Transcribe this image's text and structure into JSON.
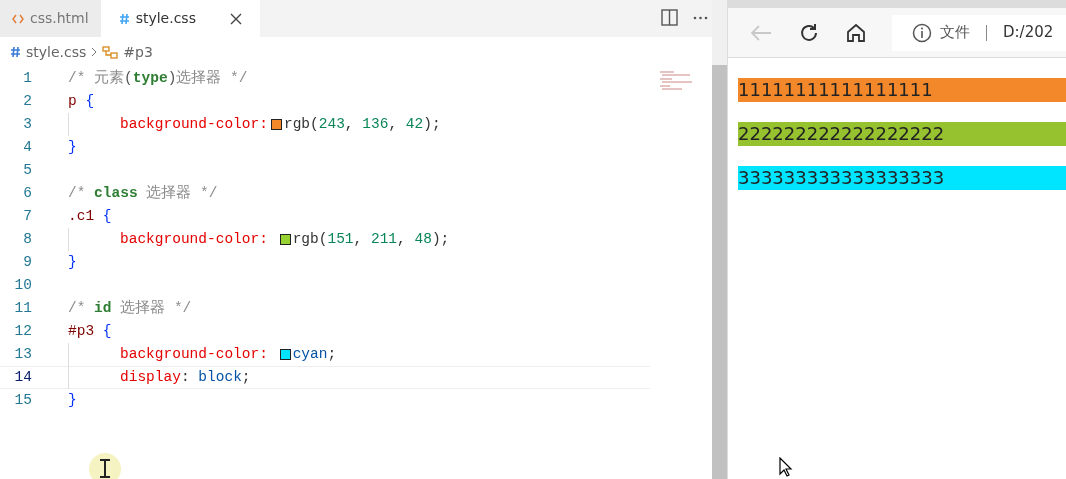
{
  "editor": {
    "tabs": [
      {
        "kind": "html",
        "label": "css.html",
        "selected": false
      },
      {
        "kind": "css",
        "label": "style.css",
        "selected": true
      }
    ],
    "breadcrumb": [
      {
        "kind": "file",
        "label": "style.css"
      },
      {
        "kind": "symbol",
        "label": "#p3"
      }
    ],
    "lines": [
      {
        "number": "1",
        "current": false,
        "tokens": [
          {
            "kind": "comment",
            "text": "/* 元素"
          },
          {
            "kind": "punct",
            "text": "("
          },
          {
            "kind": "keyword",
            "text": "type"
          },
          {
            "kind": "punct",
            "text": ")"
          },
          {
            "kind": "comment",
            "text": "选择器 */"
          }
        ]
      },
      {
        "number": "2",
        "current": false,
        "tokens": [
          {
            "kind": "selector",
            "text": "p"
          },
          {
            "kind": "brace",
            "text": " {"
          }
        ]
      },
      {
        "number": "3",
        "current": false,
        "tokens": [
          {
            "kind": "indent"
          },
          {
            "kind": "property",
            "text": "background-color:"
          },
          {
            "kind": "swatch",
            "color": "#f3882a"
          },
          {
            "kind": "plain",
            "text": "rgb("
          },
          {
            "kind": "number",
            "text": "243"
          },
          {
            "kind": "plain",
            "text": ", "
          },
          {
            "kind": "number",
            "text": "136"
          },
          {
            "kind": "plain",
            "text": ", "
          },
          {
            "kind": "number",
            "text": "42"
          },
          {
            "kind": "plain",
            "text": ");"
          }
        ]
      },
      {
        "number": "4",
        "current": false,
        "tokens": [
          {
            "kind": "brace",
            "text": "}"
          }
        ]
      },
      {
        "number": "5",
        "current": false
      },
      {
        "number": "6",
        "current": false,
        "tokens": [
          {
            "kind": "comment",
            "text": "/* "
          },
          {
            "kind": "keyword",
            "text": "class"
          },
          {
            "kind": "comment",
            "text": " 选择器 */"
          }
        ]
      },
      {
        "number": "7",
        "current": false,
        "tokens": [
          {
            "kind": "selector",
            "text": ".c1"
          },
          {
            "kind": "brace",
            "text": " {"
          }
        ]
      },
      {
        "number": "8",
        "current": false,
        "tokens": [
          {
            "kind": "indent"
          },
          {
            "kind": "property",
            "text": "background-color: "
          },
          {
            "kind": "swatch",
            "color": "#97d330"
          },
          {
            "kind": "plain",
            "text": "rgb("
          },
          {
            "kind": "number",
            "text": "151"
          },
          {
            "kind": "plain",
            "text": ", "
          },
          {
            "kind": "number",
            "text": "211"
          },
          {
            "kind": "plain",
            "text": ", "
          },
          {
            "kind": "number",
            "text": "48"
          },
          {
            "kind": "plain",
            "text": ");"
          }
        ]
      },
      {
        "number": "9",
        "current": false,
        "tokens": [
          {
            "kind": "brace",
            "text": "}"
          }
        ]
      },
      {
        "number": "10",
        "current": false
      },
      {
        "number": "11",
        "current": false,
        "tokens": [
          {
            "kind": "comment",
            "text": "/* "
          },
          {
            "kind": "keyword",
            "text": "id"
          },
          {
            "kind": "comment",
            "text": " 选择器 */"
          }
        ]
      },
      {
        "number": "12",
        "current": false,
        "tokens": [
          {
            "kind": "selector",
            "text": "#p3"
          },
          {
            "kind": "brace",
            "text": " {"
          }
        ]
      },
      {
        "number": "13",
        "current": false,
        "tokens": [
          {
            "kind": "indent"
          },
          {
            "kind": "property",
            "text": "background-color: "
          },
          {
            "kind": "swatch",
            "color": "#00e5ff"
          },
          {
            "kind": "value",
            "text": "cyan"
          },
          {
            "kind": "plain",
            "text": ";"
          }
        ]
      },
      {
        "number": "14",
        "current": true,
        "tokens": [
          {
            "kind": "indent"
          },
          {
            "kind": "property",
            "text": "display"
          },
          {
            "kind": "plain",
            "text": ": "
          },
          {
            "kind": "value",
            "text": "block"
          },
          {
            "kind": "plain",
            "text": ";"
          }
        ]
      },
      {
        "number": "15",
        "current": false,
        "tokens": [
          {
            "kind": "brace",
            "text": "}"
          }
        ]
      }
    ]
  },
  "browser": {
    "back": {
      "disabled": true
    },
    "address": {
      "scheme": "文件",
      "url": "D:/202"
    },
    "paragraphs": [
      {
        "text": "11111111111111111",
        "color": "#f3882a"
      },
      {
        "text": "222222222222222222",
        "color": "#97c230"
      },
      {
        "text": "333333333333333333",
        "color": "#00e5ff"
      }
    ]
  }
}
